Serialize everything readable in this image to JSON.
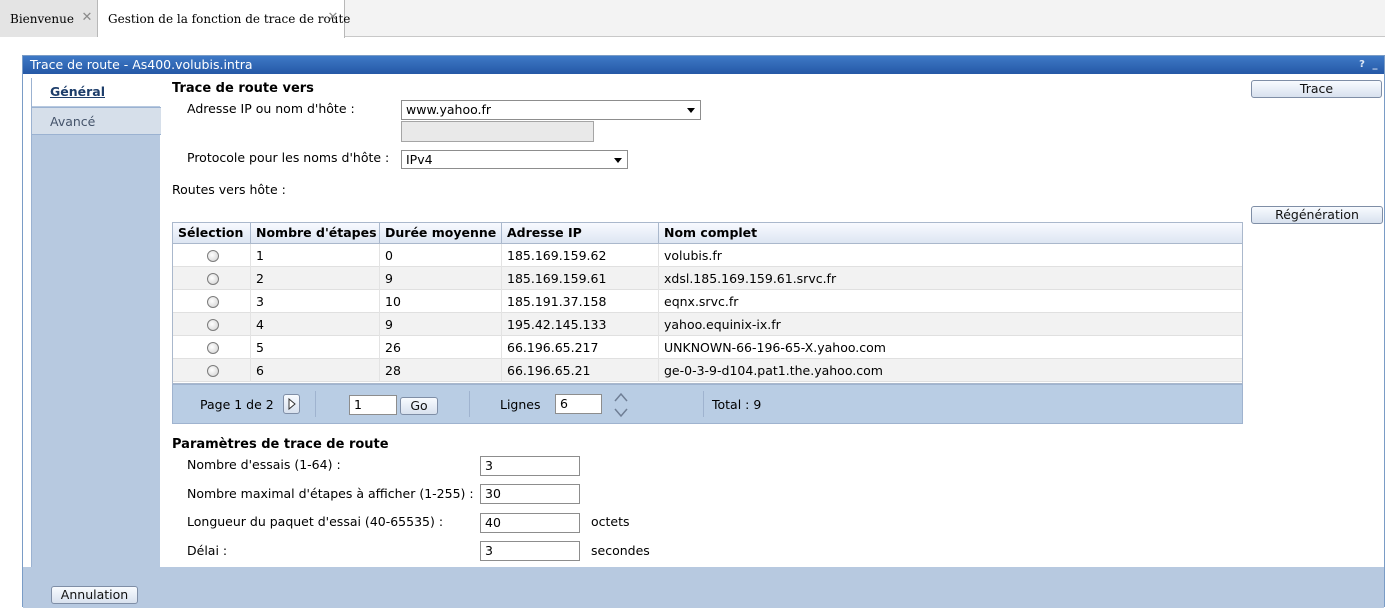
{
  "tabs": [
    {
      "label": "Bienvenue"
    },
    {
      "label": "Gestion de la fonction de trace de route"
    }
  ],
  "window": {
    "title": "Trace de route - As400.volubis.intra",
    "help": "?",
    "minimize": "_"
  },
  "sidebar": {
    "items": [
      {
        "label": "Général"
      },
      {
        "label": "Avancé"
      }
    ]
  },
  "form": {
    "heading": "Trace de route vers",
    "host_label": "Adresse IP ou nom d'hôte :",
    "host_value": "www.yahoo.fr",
    "protocol_label": "Protocole pour les noms d'hôte :",
    "protocol_value": "IPv4",
    "routes_label": "Routes vers hôte :",
    "trace_button": "Trace",
    "regen_button": "Régénération"
  },
  "table": {
    "headers": [
      "Sélection",
      "Nombre d'étapes",
      "Durée moyenne",
      "Adresse IP",
      "Nom complet"
    ],
    "rows": [
      {
        "steps": "1",
        "avg": "0",
        "ip": "185.169.159.62",
        "name": "volubis.fr"
      },
      {
        "steps": "2",
        "avg": "9",
        "ip": "185.169.159.61",
        "name": "xdsl.185.169.159.61.srvc.fr"
      },
      {
        "steps": "3",
        "avg": "10",
        "ip": "185.191.37.158",
        "name": "eqnx.srvc.fr"
      },
      {
        "steps": "4",
        "avg": "9",
        "ip": "195.42.145.133",
        "name": "yahoo.equinix-ix.fr"
      },
      {
        "steps": "5",
        "avg": "26",
        "ip": "66.196.65.217",
        "name": "UNKNOWN-66-196-65-X.yahoo.com"
      },
      {
        "steps": "6",
        "avg": "28",
        "ip": "66.196.65.21",
        "name": "ge-0-3-9-d104.pat1.the.yahoo.com"
      }
    ]
  },
  "pager": {
    "page_text": "Page 1 de 2",
    "page_input": "1",
    "go_button": "Go",
    "lines_label": "Lignes",
    "lines_value": "6",
    "total_text": "Total : 9"
  },
  "params": {
    "heading": "Paramètres de trace de route",
    "tries_label": "Nombre d'essais (1-64) :",
    "tries_value": "3",
    "maxsteps_label": "Nombre maximal d'étapes à afficher (1-255) :",
    "maxsteps_value": "30",
    "length_label": "Longueur du paquet d'essai (40-65535) :",
    "length_value": "40",
    "length_unit": "octets",
    "delay_label": "Délai :",
    "delay_value": "3",
    "delay_unit": "secondes"
  },
  "footer": {
    "cancel_button": "Annulation"
  }
}
